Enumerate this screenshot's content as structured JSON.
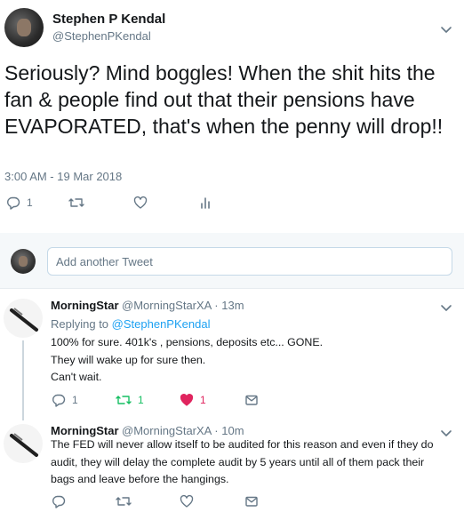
{
  "main_tweet": {
    "author_name": "Stephen P Kendal",
    "author_handle": "@StephenPKendal",
    "text": "Seriously? Mind boggles! When the shit hits the fan & people find out that their pensions have EVAPORATED, that's when the penny will drop!!",
    "timestamp": "3:00 AM - 19 Mar 2018",
    "reply_count": "1"
  },
  "composer": {
    "placeholder": "Add another Tweet"
  },
  "replies": [
    {
      "author_name": "MorningStar",
      "author_handle": "@MorningStarXA",
      "separator": "·",
      "time": "13m",
      "replying_prefix": "Replying to",
      "replying_to": "@StephenPKendal",
      "lines": [
        "100% for sure. 401k's , pensions, deposits etc... GONE.",
        "They will wake up for sure then.",
        "Can't wait."
      ],
      "reply_count": "1",
      "retweet_count": "1",
      "like_count": "1"
    },
    {
      "author_name": "MorningStar",
      "author_handle": "@MorningStarXA",
      "separator": "·",
      "time": "10m",
      "lines": [
        "The FED will never allow itself to be audited for this reason and even if they do",
        "audit, they will delay the complete audit by 5 years until all of them pack their",
        "bags and leave before the hangings."
      ]
    }
  ],
  "colors": {
    "link": "#1da1f2",
    "secondary_text": "#657786",
    "retweet_active": "#17bf63",
    "like_active": "#e0245e"
  }
}
